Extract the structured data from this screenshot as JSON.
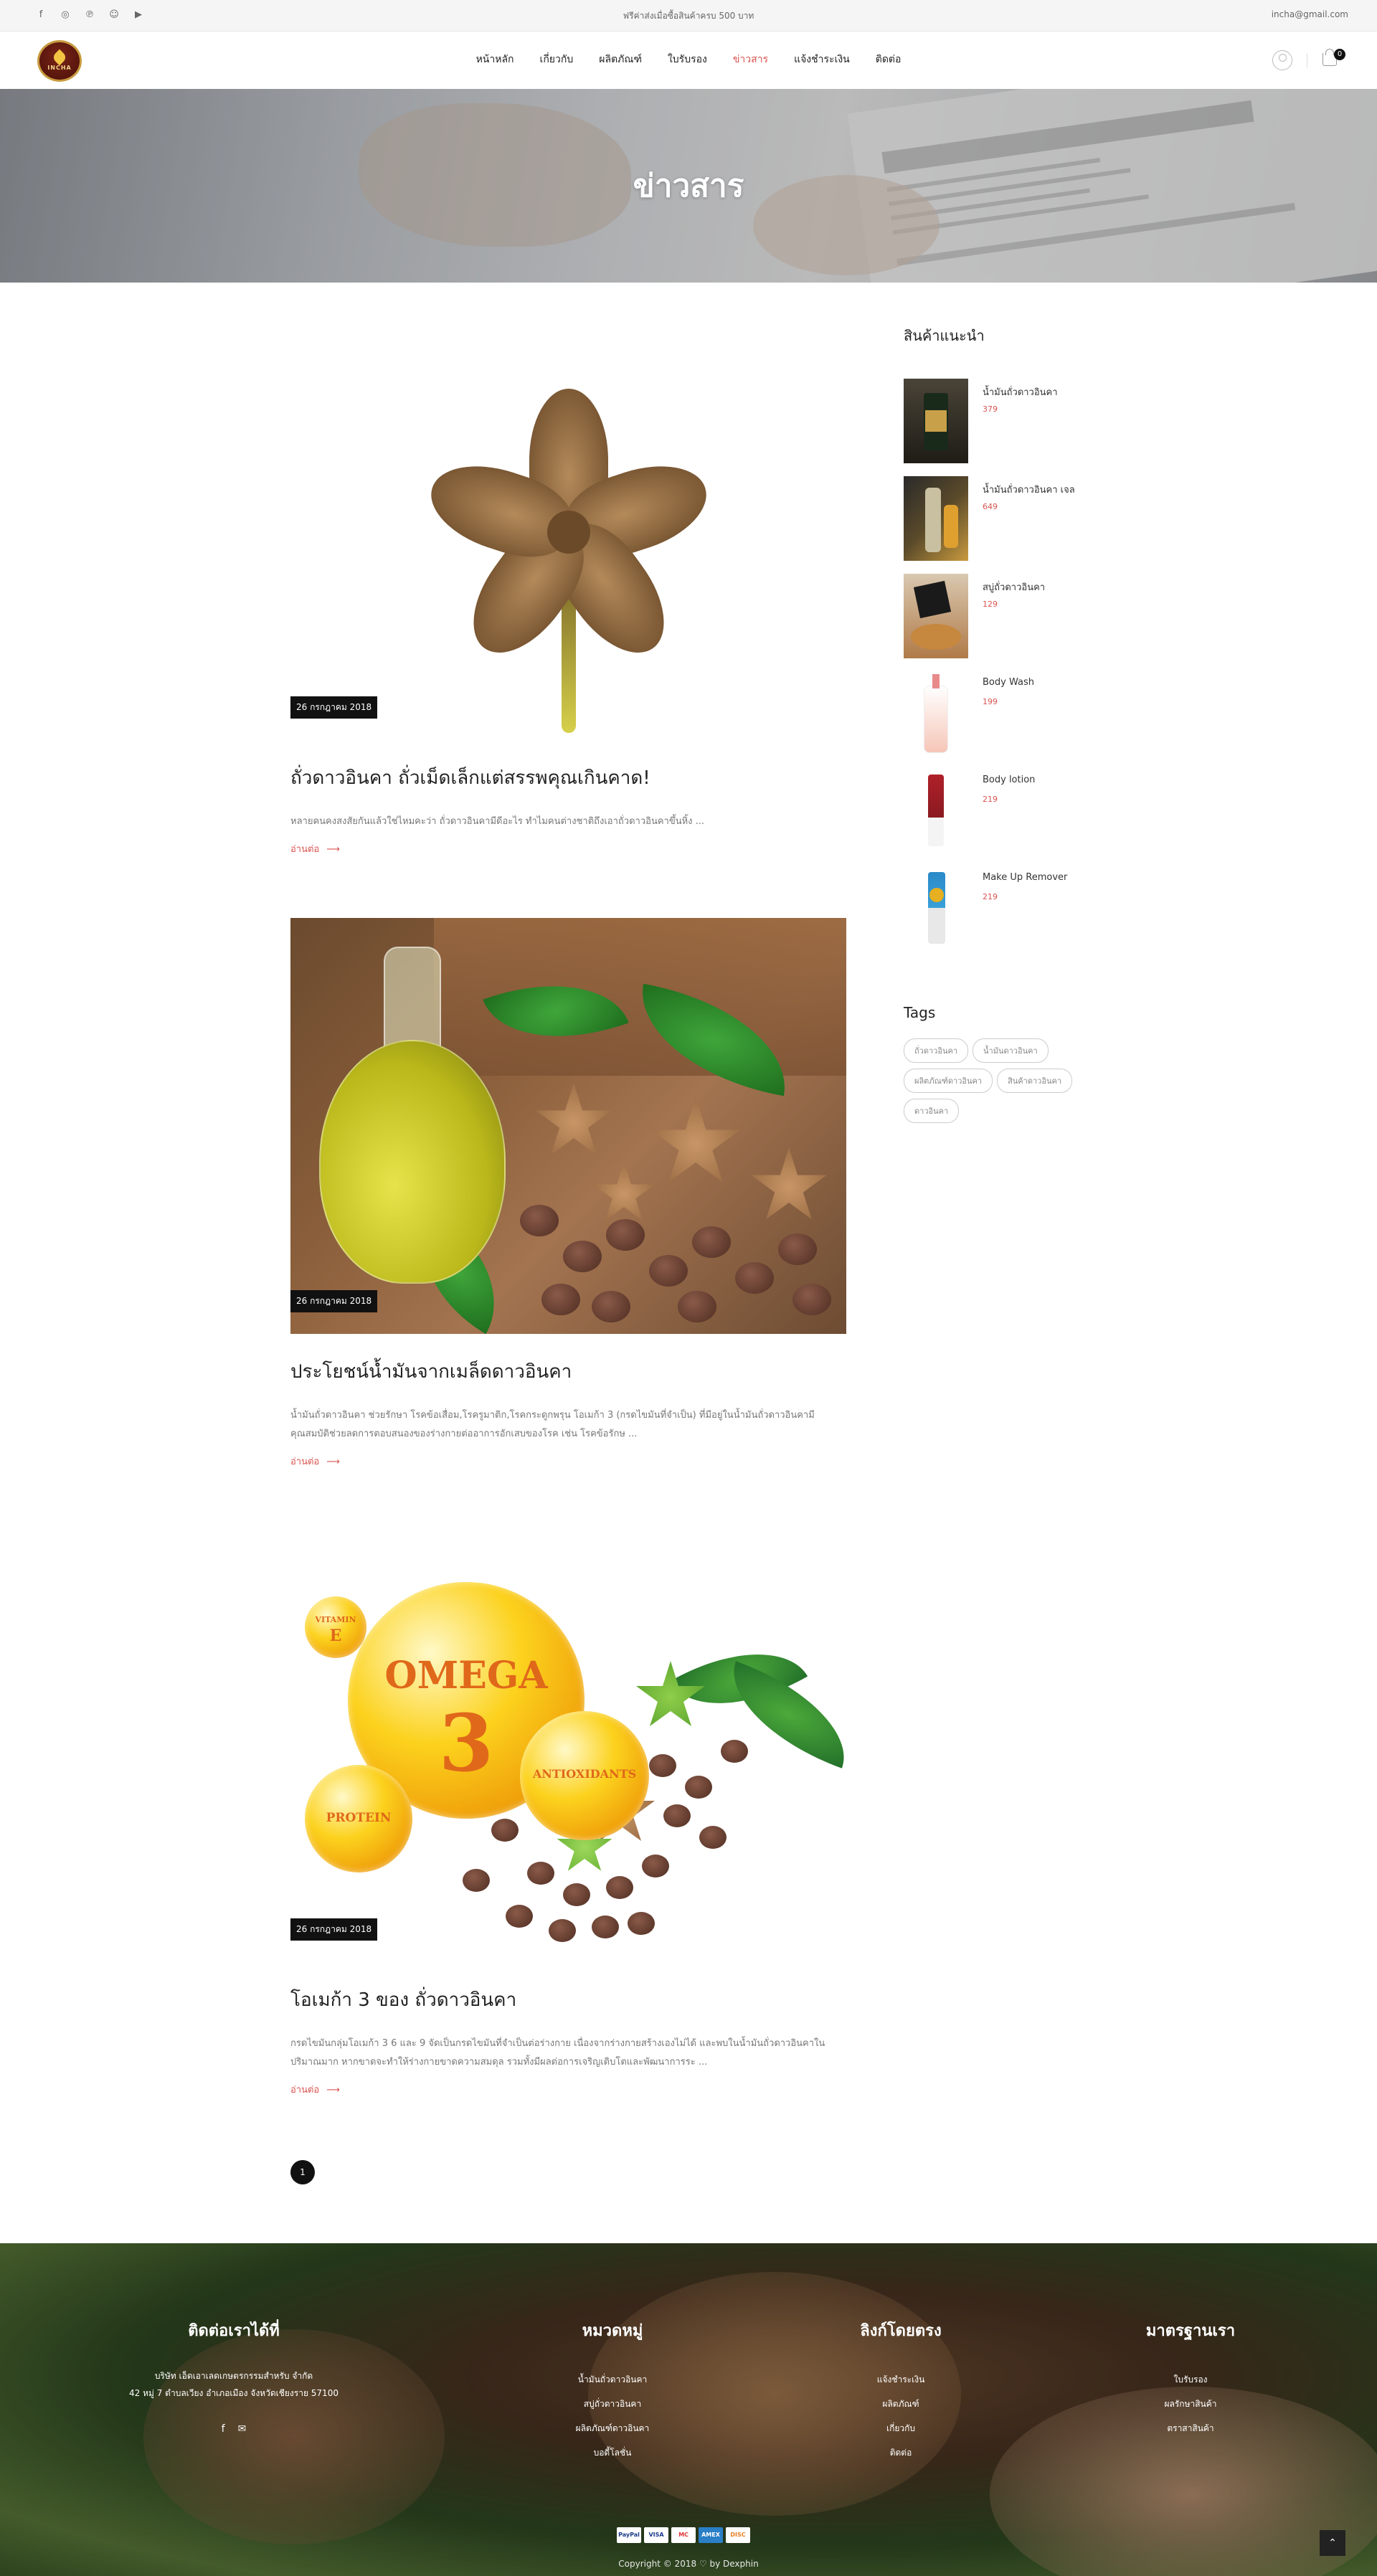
{
  "topbar": {
    "socials": [
      "facebook-icon",
      "instagram-icon",
      "pinterest-icon",
      "snapchat-icon",
      "youtube-icon"
    ],
    "promo": "ฟรีค่าส่งเมื่อซื้อสินค้าครบ 500 บาท",
    "email": "incha@gmail.com"
  },
  "header": {
    "logo_text": "INCHA",
    "nav": [
      "หน้าหลัก",
      "เกี่ยวกับ",
      "ผลิตภัณฑ์",
      "ใบรับรอง",
      "ข่าวสาร",
      "แจ้งชำระเงิน",
      "ติดต่อ"
    ],
    "active_nav": "ข่าวสาร",
    "cart_count": "0"
  },
  "banner": {
    "title": "ข่าวสาร"
  },
  "posts": [
    {
      "date": "26 กรกฎาคม 2018",
      "title": "ถั่วดาวอินคา ถั่วเม็ดเล็กแต่สรรพคุณเกินคาด!",
      "excerpt": "หลายคนคงสงสัยกันแล้วใช่ไหมคะว่า ถั่วดาวอินคามีดีอะไร ทำไมคนต่างชาติถึงเอาถั่วดาวอินคาขึ้นหิ้ง ...",
      "more": "อ่านต่อ"
    },
    {
      "date": "26 กรกฎาคม 2018",
      "title": "ประโยชน์น้ำมันจากเมล็ดดาวอินคา",
      "excerpt": "น้ำมันถั่วดาวอินคา ช่วยรักษา โรคข้อเสื่อม,โรครูมาติก,โรคกระดูกพรุน โอเมก้า 3 (กรดไขมันที่จำเป็น) ที่มีอยู่ในน้ำมันถั่วดาวอินคามีคุณสมบัติช่วยลดการตอบสนองของร่างกายต่ออาการอักเสบของโรค เช่น โรคข้อรักษ ...",
      "more": "อ่านต่อ"
    },
    {
      "date": "26 กรกฎาคม 2018",
      "title": "โอเมก้า 3 ของ ถั่วดาวอินคา",
      "excerpt": "กรดไขมันกลุ่มโอเมก้า 3 6 และ 9 จัดเป็นกรดไขมันที่จำเป็นต่อร่างกาย เนื่องจากร่างกายสร้างเองไม่ได้ และพบในน้ำมันถั่วดาวอินคาในปริมาณมาก หากขาดจะทำให้ร่างกายขาดความสมดุล รวมทั้งมีผลต่อการเจริญเติบโตและพัฒนาการระ ...",
      "more": "อ่านต่อ"
    }
  ],
  "image_labels": {
    "vitamin": "VITAMIN",
    "vitamin_letter": "E",
    "omega": "OMEGA",
    "omega_number": "3",
    "antioxidants": "ANTIOXIDANTS",
    "protein": "PROTEIN"
  },
  "pagination": {
    "current": "1"
  },
  "sidebar": {
    "featured_title": "สินค้าแนะนำ",
    "products": [
      {
        "name": "น้ำมันถั่วดาวอินคา",
        "price": "379"
      },
      {
        "name": "น้ำมันถั่วดาวอินคา เจล",
        "price": "649"
      },
      {
        "name": "สบู่ถั่วดาวอินคา",
        "price": "129"
      },
      {
        "name": "Body Wash",
        "price": "199"
      },
      {
        "name": "Body lotion",
        "price": "219"
      },
      {
        "name": "Make Up Remover",
        "price": "219"
      }
    ],
    "tags_title": "Tags",
    "tags": [
      "ถั่วดาวอินคา",
      "น้ำมันดาวอินคา",
      "ผลิตภัณฑ์ดาวอินคา",
      "สินค้าดาวอินคา",
      "ดาวอินคา"
    ]
  },
  "footer": {
    "contact": {
      "title": "ติดต่อเราได้ที่",
      "address_line1": "บริษัท เอ็ดเอาเลดเกษตรกรรมสำหรับ จำกัด",
      "address_line2": "42 หมู่ 7 ตำบลเวียง อำเภอเมือง จังหวัดเชียงราย 57100"
    },
    "categories": {
      "title": "หมวดหมู่",
      "links": [
        "น้ำมันถั่วดาวอินคา",
        "สบู่ถั่วดาวอินคา",
        "ผลิตภัณฑ์ดาวอินคา",
        "บอดี้โลชั่น"
      ]
    },
    "direct_links": {
      "title": "ลิงก์โดยตรง",
      "links": [
        "แจ้งชำระเงิน",
        "ผลิตภัณฑ์",
        "เกี่ยวกับ",
        "ติดต่อ"
      ]
    },
    "standards": {
      "title": "มาตรฐานเรา",
      "links": [
        "ใบรับรอง",
        "ผลรักษาสินค้า",
        "ตราสาสินค้า"
      ]
    },
    "payments": [
      "PayPal",
      "VISA",
      "MC",
      "AMEX",
      "DISC"
    ],
    "copyright": "Copyright © 2018 ♡ by Dexphin"
  }
}
